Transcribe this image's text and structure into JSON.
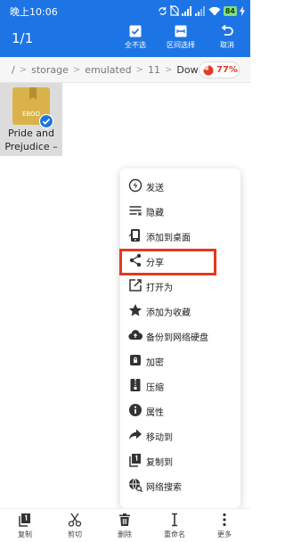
{
  "status_bar": {
    "time": "晚上10:06",
    "battery": "84",
    "icons": [
      "sync-icon",
      "sim-off-icon",
      "signal-icon",
      "signal-icon",
      "wifi-icon",
      "battery-icon",
      "charging-icon"
    ]
  },
  "app_bar": {
    "selection_count": "1/1",
    "actions": [
      {
        "label": "全不选",
        "icon": "checkbox-icon"
      },
      {
        "label": "区间选择",
        "icon": "range-select-icon"
      },
      {
        "label": "取消",
        "icon": "undo-icon"
      }
    ]
  },
  "breadcrumb": {
    "items": [
      "/",
      "storage",
      "emulated",
      "11",
      "Download"
    ],
    "storage_usage": "77%",
    "storage_color": "#e0392b"
  },
  "file": {
    "name": "Pride and Prejudice –",
    "icon_text": "EBOO",
    "selected": true
  },
  "menu": {
    "items": [
      {
        "label": "发送",
        "icon": "send-icon"
      },
      {
        "label": "隐藏",
        "icon": "hide-icon"
      },
      {
        "label": "添加到桌面",
        "icon": "add-to-desktop-icon"
      },
      {
        "label": "分享",
        "icon": "share-icon"
      },
      {
        "label": "打开为",
        "icon": "open-as-icon"
      },
      {
        "label": "添加为收藏",
        "icon": "star-icon"
      },
      {
        "label": "备份到网络硬盘",
        "icon": "cloud-upload-icon"
      },
      {
        "label": "加密",
        "icon": "lock-icon"
      },
      {
        "label": "压缩",
        "icon": "compress-icon"
      },
      {
        "label": "属性",
        "icon": "info-icon"
      },
      {
        "label": "移动到",
        "icon": "move-icon"
      },
      {
        "label": "复制到",
        "icon": "copy-to-icon"
      },
      {
        "label": "网络搜索",
        "icon": "web-search-icon"
      }
    ],
    "highlighted": "分享",
    "highlight_color": "#e5391c"
  },
  "bottom_bar": {
    "items": [
      {
        "label": "复制",
        "icon": "copy-icon"
      },
      {
        "label": "剪切",
        "icon": "scissors-icon"
      },
      {
        "label": "删除",
        "icon": "trash-icon"
      },
      {
        "label": "重命名",
        "icon": "rename-icon"
      },
      {
        "label": "更多",
        "icon": "more-icon"
      }
    ]
  },
  "colors": {
    "primary": "#1d74e4",
    "book": "#d9b34a",
    "check": "#1d74e4"
  }
}
